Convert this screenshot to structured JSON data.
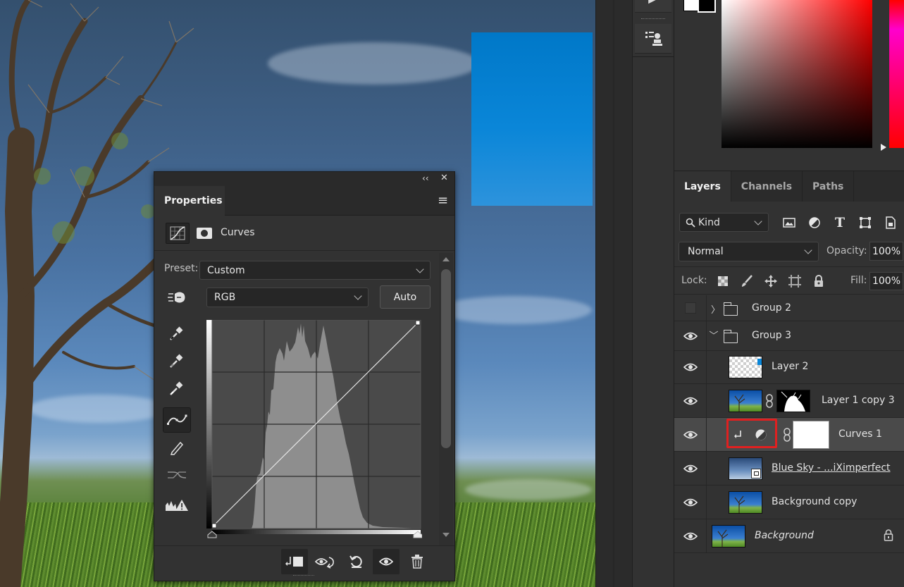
{
  "properties_panel": {
    "tab_label": "Properties",
    "adjustment_name": "Curves",
    "preset_label": "Preset:",
    "preset_value": "Custom",
    "channel_value": "RGB",
    "auto_label": "Auto",
    "collapse_glyph": "‹‹",
    "close_glyph": "✕",
    "menu_glyph": "≡",
    "tools": [
      "hand-target-icon",
      "black-point-eyedropper-icon",
      "gray-point-eyedropper-icon",
      "white-point-eyedropper-icon",
      "curve-points-icon",
      "pencil-icon",
      "smooth-curve-icon",
      "clipping-warning-icon"
    ],
    "footer_buttons": [
      "clip-to-layer-icon",
      "view-previous-state-icon",
      "reset-icon",
      "visibility-eye-icon",
      "trash-icon"
    ]
  },
  "layers_panel": {
    "tabs": [
      "Layers",
      "Channels",
      "Paths"
    ],
    "kind_label": "Kind",
    "blend_mode": "Normal",
    "opacity_label": "Opacity:",
    "opacity_value": "100%",
    "lock_label": "Lock:",
    "fill_label": "Fill:",
    "fill_value": "100%",
    "layers": [
      {
        "name": "Group 2",
        "type": "group",
        "visible": false,
        "expanded": false
      },
      {
        "name": "Group 3",
        "type": "group",
        "visible": true,
        "expanded": true
      },
      {
        "name": "Layer 2",
        "type": "pixel",
        "visible": true
      },
      {
        "name": "Layer 1 copy 3",
        "type": "pixel-with-mask",
        "visible": true
      },
      {
        "name": "Curves 1",
        "type": "adjustment",
        "visible": true,
        "selected": true
      },
      {
        "name": "Blue Sky - ...iXimperfect",
        "type": "smart-object",
        "visible": true
      },
      {
        "name": "Background copy",
        "type": "pixel",
        "visible": true
      },
      {
        "name": "Background",
        "type": "background",
        "visible": true,
        "locked": true
      }
    ]
  },
  "colors": {
    "panel_bg": "#323232",
    "highlight_red": "#e02020",
    "blue_rect": "#0a86d8"
  }
}
